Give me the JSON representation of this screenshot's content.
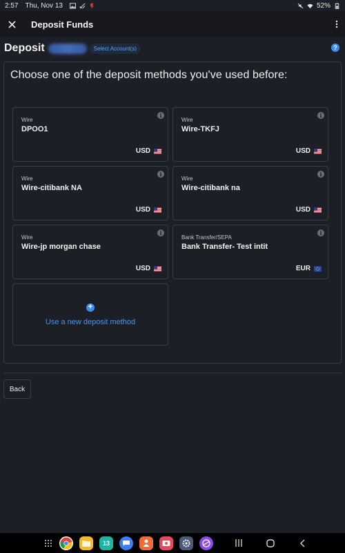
{
  "status_bar": {
    "time": "2:57",
    "date": "Thu, Nov 13",
    "battery": "52%"
  },
  "header": {
    "title": "Deposit Funds"
  },
  "deposit_row": {
    "label": "Deposit",
    "select_account_label": "Select Account(s)",
    "help_label": "?"
  },
  "panel": {
    "title": "Choose one of the deposit methods you've used before:"
  },
  "methods": [
    {
      "type": "Wire",
      "name": "DPOO1",
      "currency": "USD",
      "flag": "us-flag"
    },
    {
      "type": "Wire",
      "name": "Wire-TKFJ",
      "currency": "USD",
      "flag": "us-flag"
    },
    {
      "type": "Wire",
      "name": "Wire-citibank NA",
      "currency": "USD",
      "flag": "us-flag"
    },
    {
      "type": "Wire",
      "name": "Wire-citibank na",
      "currency": "USD",
      "flag": "us-flag"
    },
    {
      "type": "Wire",
      "name": "Wire-jp morgan chase",
      "currency": "USD",
      "flag": "us-flag"
    },
    {
      "type": "Bank Transfer/SEPA",
      "name": "Bank Transfer- Test intit",
      "currency": "EUR",
      "flag": "eu-flag"
    }
  ],
  "new_method": {
    "label": "Use a new deposit method"
  },
  "footer": {
    "back_label": "Back"
  },
  "dock": {
    "calendar_day": "13"
  },
  "colors": {
    "background": "#1d1f26",
    "header": "#16181d",
    "accent": "#3d8ef0",
    "border": "#3a3d45"
  }
}
